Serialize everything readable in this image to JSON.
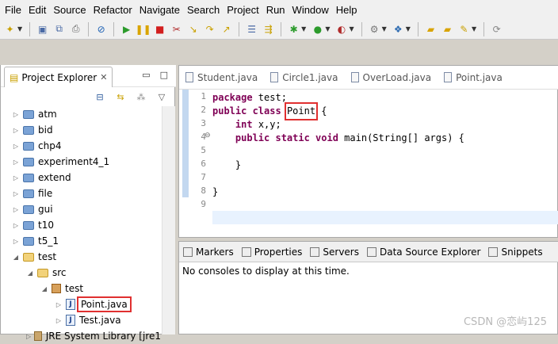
{
  "menu": [
    "File",
    "Edit",
    "Source",
    "Refactor",
    "Navigate",
    "Search",
    "Project",
    "Run",
    "Window",
    "Help"
  ],
  "project_explorer": {
    "title": "Project Explorer",
    "close_glyph": "✕",
    "min_glyph": "▭",
    "max_glyph": "□",
    "tree": [
      {
        "label": "atm",
        "depth": 0,
        "type": "project"
      },
      {
        "label": "bid",
        "depth": 0,
        "type": "project"
      },
      {
        "label": "chp4",
        "depth": 0,
        "type": "project"
      },
      {
        "label": "experiment4_1",
        "depth": 0,
        "type": "project"
      },
      {
        "label": "extend",
        "depth": 0,
        "type": "project"
      },
      {
        "label": "file",
        "depth": 0,
        "type": "project"
      },
      {
        "label": "gui",
        "depth": 0,
        "type": "project"
      },
      {
        "label": "t10",
        "depth": 0,
        "type": "project"
      },
      {
        "label": "t5_1",
        "depth": 0,
        "type": "project"
      },
      {
        "label": "test",
        "depth": 0,
        "type": "project-open"
      },
      {
        "label": "src",
        "depth": 1,
        "type": "folder-open"
      },
      {
        "label": "test",
        "depth": 2,
        "type": "package"
      },
      {
        "label": "Point.java",
        "depth": 3,
        "type": "java",
        "highlight": true
      },
      {
        "label": "Test.java",
        "depth": 3,
        "type": "java"
      },
      {
        "label": "JRE System Library [jre1",
        "depth": 1,
        "type": "library"
      }
    ]
  },
  "editor": {
    "tabs": [
      "Student.java",
      "Circle1.java",
      "OverLoad.java",
      "Point.java"
    ],
    "lines": [
      {
        "n": "1",
        "kw": "package",
        "rest": " test;"
      },
      {
        "n": "2",
        "kw": "public class",
        "hl": "Point",
        "rest": " {"
      },
      {
        "n": "3",
        "kw": "int",
        "rest": " x,y;",
        "indent": "    "
      },
      {
        "n": "4",
        "kw": "public static void",
        "rest": " main(String[] args) {",
        "indent": "    "
      },
      {
        "n": "5",
        "kw": "",
        "rest": ""
      },
      {
        "n": "6",
        "kw": "",
        "rest": "}",
        "indent": "    "
      },
      {
        "n": "7",
        "kw": "",
        "rest": ""
      },
      {
        "n": "8",
        "kw": "",
        "rest": "}"
      },
      {
        "n": "9",
        "kw": "",
        "rest": ""
      }
    ]
  },
  "lower_panel": {
    "tabs": [
      "Markers",
      "Properties",
      "Servers",
      "Data Source Explorer",
      "Snippets"
    ],
    "message": "No consoles to display at this time."
  },
  "watermark": "CSDN @恋屿125"
}
